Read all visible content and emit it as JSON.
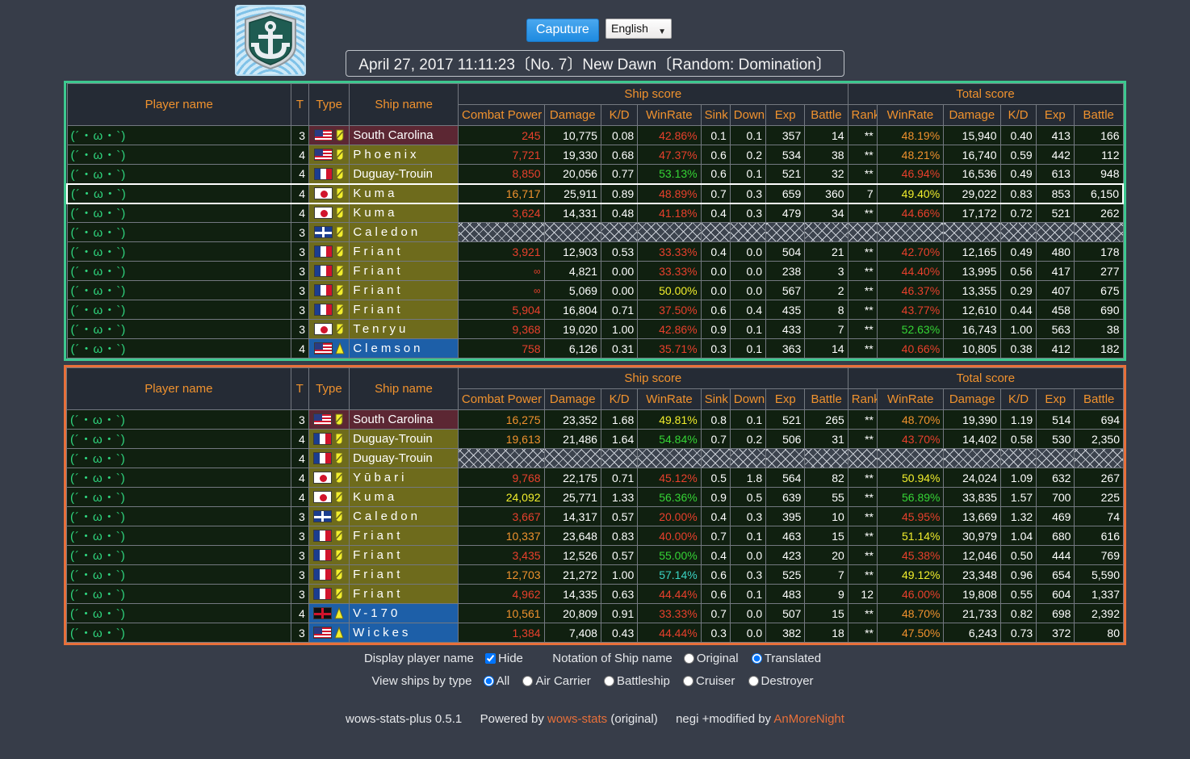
{
  "header": {
    "logo_icon": "wows-anchor-emblem",
    "capture_button": "Caputure",
    "language": "English",
    "battle_title": "April 27, 2017 11:11:23〔No. 7〕New Dawn〔Random: Domination〕"
  },
  "columns": {
    "player": "Player name",
    "tier": "T",
    "type": "Type",
    "ship": "Ship name",
    "ship_score_group": "Ship score",
    "total_score_group": "Total score",
    "combat_power": "Combat Power",
    "damage": "Damage",
    "kd": "K/D",
    "winrate": "WinRate",
    "sink": "Sink",
    "down": "Down",
    "exp": "Exp",
    "battle": "Battle",
    "rank": "Rank",
    "t_winrate": "WinRate",
    "t_damage": "Damage",
    "t_kd": "K/D",
    "t_exp": "Exp",
    "t_battle": "Battle"
  },
  "colors": {
    "ally_border": "#3dc88f",
    "enemy_border": "#e8703a",
    "header_text": "#f0922e",
    "page_bg": "#373d49",
    "row_bg": "#102010",
    "cruiser": "#6e6b1c",
    "battleship": "#5c2733",
    "destroyer": "#1d5fa8"
  },
  "player_name": "(´・ω・`)",
  "teams": [
    {
      "side": "ally",
      "rows": [
        {
          "player": "(´・ω・`)",
          "tier": "3",
          "flag": "usa",
          "cls": "battleship",
          "ship": "South Carolina",
          "wide": false,
          "nodata": false,
          "cp": "245",
          "cp_c": "v-red",
          "dmg": "10,775",
          "kd": "0.08",
          "wr": "42.86%",
          "wr_c": "v-red",
          "sink": "0.1",
          "down": "0.1",
          "exp": "357",
          "battle": "14",
          "rank": "**",
          "twr": "48.19%",
          "twr_c": "v-orange",
          "tdmg": "15,940",
          "tkd": "0.40",
          "texp": "413",
          "tbattle": "166"
        },
        {
          "player": "(´・ω・`)",
          "tier": "4",
          "flag": "usa",
          "cls": "cruiser",
          "ship": "Phoenix",
          "wide": true,
          "nodata": false,
          "cp": "7,721",
          "cp_c": "v-red",
          "dmg": "19,330",
          "kd": "0.68",
          "wr": "47.37%",
          "wr_c": "v-red",
          "sink": "0.6",
          "down": "0.2",
          "exp": "534",
          "battle": "38",
          "rank": "**",
          "twr": "48.21%",
          "twr_c": "v-orange",
          "tdmg": "16,740",
          "tkd": "0.59",
          "texp": "442",
          "tbattle": "112"
        },
        {
          "player": "(´・ω・`)",
          "tier": "4",
          "flag": "france",
          "cls": "cruiser",
          "ship": "Duguay-Trouin",
          "wide": false,
          "nodata": false,
          "cp": "8,850",
          "cp_c": "v-red",
          "dmg": "20,056",
          "kd": "0.77",
          "wr": "53.13%",
          "wr_c": "v-green",
          "sink": "0.6",
          "down": "0.1",
          "exp": "521",
          "battle": "32",
          "rank": "**",
          "twr": "46.94%",
          "twr_c": "v-red",
          "tdmg": "16,536",
          "tkd": "0.49",
          "texp": "613",
          "tbattle": "948"
        },
        {
          "player": "(´・ω・`)",
          "tier": "4",
          "flag": "japan",
          "cls": "cruiser",
          "ship": "Kuma",
          "wide": true,
          "nodata": false,
          "highlight": true,
          "cp": "16,717",
          "cp_c": "v-orange",
          "dmg": "25,911",
          "kd": "0.89",
          "wr": "48.89%",
          "wr_c": "v-red",
          "sink": "0.7",
          "down": "0.3",
          "exp": "659",
          "battle": "360",
          "rank": "7",
          "twr": "49.40%",
          "twr_c": "v-yellow",
          "tdmg": "29,022",
          "tkd": "0.83",
          "texp": "853",
          "tbattle": "6,150"
        },
        {
          "player": "(´・ω・`)",
          "tier": "4",
          "flag": "japan",
          "cls": "cruiser",
          "ship": "Kuma",
          "wide": true,
          "nodata": false,
          "cp": "3,624",
          "cp_c": "v-red",
          "dmg": "14,331",
          "kd": "0.48",
          "wr": "41.18%",
          "wr_c": "v-red",
          "sink": "0.4",
          "down": "0.3",
          "exp": "479",
          "battle": "34",
          "rank": "**",
          "twr": "44.66%",
          "twr_c": "v-red",
          "tdmg": "17,172",
          "tkd": "0.72",
          "texp": "521",
          "tbattle": "262"
        },
        {
          "player": "(´・ω・`)",
          "tier": "3",
          "flag": "uk",
          "cls": "cruiser",
          "ship": "Caledon",
          "wide": true,
          "nodata": true,
          "cp": "",
          "cp_c": "",
          "dmg": "",
          "kd": "",
          "wr": "",
          "wr_c": "",
          "sink": "",
          "down": "",
          "exp": "",
          "battle": "",
          "rank": "",
          "twr": "",
          "twr_c": "",
          "tdmg": "",
          "tkd": "",
          "texp": "",
          "tbattle": ""
        },
        {
          "player": "(´・ω・`)",
          "tier": "3",
          "flag": "france",
          "cls": "cruiser",
          "ship": "Friant",
          "wide": true,
          "nodata": false,
          "cp": "3,921",
          "cp_c": "v-red",
          "dmg": "12,903",
          "kd": "0.53",
          "wr": "33.33%",
          "wr_c": "v-red",
          "sink": "0.4",
          "down": "0.0",
          "exp": "504",
          "battle": "21",
          "rank": "**",
          "twr": "42.70%",
          "twr_c": "v-red",
          "tdmg": "12,165",
          "tkd": "0.49",
          "texp": "480",
          "tbattle": "178"
        },
        {
          "player": "(´・ω・`)",
          "tier": "3",
          "flag": "france",
          "cls": "cruiser",
          "ship": "Friant",
          "wide": true,
          "nodata": false,
          "cp": "∞",
          "cp_c": "inf",
          "dmg": "4,821",
          "kd": "0.00",
          "wr": "33.33%",
          "wr_c": "v-red",
          "sink": "0.0",
          "down": "0.0",
          "exp": "238",
          "battle": "3",
          "rank": "**",
          "twr": "44.40%",
          "twr_c": "v-red",
          "tdmg": "13,995",
          "tkd": "0.56",
          "texp": "417",
          "tbattle": "277"
        },
        {
          "player": "(´・ω・`)",
          "tier": "3",
          "flag": "france",
          "cls": "cruiser",
          "ship": "Friant",
          "wide": true,
          "nodata": false,
          "cp": "∞",
          "cp_c": "inf",
          "dmg": "5,069",
          "kd": "0.00",
          "wr": "50.00%",
          "wr_c": "v-yellow",
          "sink": "0.0",
          "down": "0.0",
          "exp": "567",
          "battle": "2",
          "rank": "**",
          "twr": "46.37%",
          "twr_c": "v-red",
          "tdmg": "13,355",
          "tkd": "0.29",
          "texp": "407",
          "tbattle": "675"
        },
        {
          "player": "(´・ω・`)",
          "tier": "3",
          "flag": "france",
          "cls": "cruiser",
          "ship": "Friant",
          "wide": true,
          "nodata": false,
          "cp": "5,904",
          "cp_c": "v-red",
          "dmg": "16,804",
          "kd": "0.71",
          "wr": "37.50%",
          "wr_c": "v-red",
          "sink": "0.6",
          "down": "0.4",
          "exp": "435",
          "battle": "8",
          "rank": "**",
          "twr": "43.77%",
          "twr_c": "v-red",
          "tdmg": "12,610",
          "tkd": "0.44",
          "texp": "458",
          "tbattle": "690"
        },
        {
          "player": "(´・ω・`)",
          "tier": "3",
          "flag": "japan",
          "cls": "cruiser",
          "ship": "Tenryu",
          "wide": true,
          "nodata": false,
          "cp": "9,368",
          "cp_c": "v-red",
          "dmg": "19,020",
          "kd": "1.00",
          "wr": "42.86%",
          "wr_c": "v-red",
          "sink": "0.9",
          "down": "0.1",
          "exp": "433",
          "battle": "7",
          "rank": "**",
          "twr": "52.63%",
          "twr_c": "v-green",
          "tdmg": "16,743",
          "tkd": "1.00",
          "texp": "563",
          "tbattle": "38"
        },
        {
          "player": "(´・ω・`)",
          "tier": "4",
          "flag": "usa",
          "cls": "destroyer",
          "ship": "Clemson",
          "wide": true,
          "nodata": false,
          "cp": "758",
          "cp_c": "v-red",
          "dmg": "6,126",
          "kd": "0.31",
          "wr": "35.71%",
          "wr_c": "v-red",
          "sink": "0.3",
          "down": "0.1",
          "exp": "363",
          "battle": "14",
          "rank": "**",
          "twr": "40.66%",
          "twr_c": "v-red",
          "tdmg": "10,805",
          "tkd": "0.38",
          "texp": "412",
          "tbattle": "182"
        }
      ]
    },
    {
      "side": "enemy",
      "rows": [
        {
          "player": "(´・ω・`)",
          "tier": "3",
          "flag": "usa",
          "cls": "battleship",
          "ship": "South Carolina",
          "wide": false,
          "nodata": false,
          "cp": "16,275",
          "cp_c": "v-orange",
          "dmg": "23,352",
          "kd": "1.68",
          "wr": "49.81%",
          "wr_c": "v-yellow",
          "sink": "0.8",
          "down": "0.1",
          "exp": "521",
          "battle": "265",
          "rank": "**",
          "twr": "48.70%",
          "twr_c": "v-orange",
          "tdmg": "19,390",
          "tkd": "1.19",
          "texp": "514",
          "tbattle": "694"
        },
        {
          "player": "(´・ω・`)",
          "tier": "4",
          "flag": "france",
          "cls": "cruiser",
          "ship": "Duguay-Trouin",
          "wide": false,
          "nodata": false,
          "cp": "19,613",
          "cp_c": "v-orange",
          "dmg": "21,486",
          "kd": "1.64",
          "wr": "54.84%",
          "wr_c": "v-green",
          "sink": "0.7",
          "down": "0.2",
          "exp": "506",
          "battle": "31",
          "rank": "**",
          "twr": "43.70%",
          "twr_c": "v-red",
          "tdmg": "14,402",
          "tkd": "0.58",
          "texp": "530",
          "tbattle": "2,350"
        },
        {
          "player": "(´・ω・`)",
          "tier": "4",
          "flag": "france",
          "cls": "cruiser",
          "ship": "Duguay-Trouin",
          "wide": false,
          "nodata": true,
          "cp": "",
          "cp_c": "",
          "dmg": "",
          "kd": "",
          "wr": "",
          "wr_c": "",
          "sink": "",
          "down": "",
          "exp": "",
          "battle": "",
          "rank": "",
          "twr": "",
          "twr_c": "",
          "tdmg": "",
          "tkd": "",
          "texp": "",
          "tbattle": ""
        },
        {
          "player": "(´・ω・`)",
          "tier": "4",
          "flag": "japan",
          "cls": "cruiser",
          "ship": "Yūbari",
          "wide": true,
          "nodata": false,
          "cp": "9,768",
          "cp_c": "v-red",
          "dmg": "22,175",
          "kd": "0.71",
          "wr": "45.12%",
          "wr_c": "v-red",
          "sink": "0.5",
          "down": "1.8",
          "exp": "564",
          "battle": "82",
          "rank": "**",
          "twr": "50.94%",
          "twr_c": "v-yellow",
          "tdmg": "24,024",
          "tkd": "1.09",
          "texp": "632",
          "tbattle": "267"
        },
        {
          "player": "(´・ω・`)",
          "tier": "4",
          "flag": "japan",
          "cls": "cruiser",
          "ship": "Kuma",
          "wide": true,
          "nodata": false,
          "cp": "24,092",
          "cp_c": "v-yellow",
          "dmg": "25,771",
          "kd": "1.33",
          "wr": "56.36%",
          "wr_c": "v-green",
          "sink": "0.9",
          "down": "0.5",
          "exp": "639",
          "battle": "55",
          "rank": "**",
          "twr": "56.89%",
          "twr_c": "v-green",
          "tdmg": "33,835",
          "tkd": "1.57",
          "texp": "700",
          "tbattle": "225"
        },
        {
          "player": "(´・ω・`)",
          "tier": "3",
          "flag": "uk",
          "cls": "cruiser",
          "ship": "Caledon",
          "wide": true,
          "nodata": false,
          "cp": "3,667",
          "cp_c": "v-red",
          "dmg": "14,317",
          "kd": "0.57",
          "wr": "20.00%",
          "wr_c": "v-red",
          "sink": "0.4",
          "down": "0.3",
          "exp": "395",
          "battle": "10",
          "rank": "**",
          "twr": "45.95%",
          "twr_c": "v-red",
          "tdmg": "13,669",
          "tkd": "1.32",
          "texp": "469",
          "tbattle": "74"
        },
        {
          "player": "(´・ω・`)",
          "tier": "3",
          "flag": "france",
          "cls": "cruiser",
          "ship": "Friant",
          "wide": true,
          "nodata": false,
          "cp": "10,337",
          "cp_c": "v-orange",
          "dmg": "23,648",
          "kd": "0.83",
          "wr": "40.00%",
          "wr_c": "v-red",
          "sink": "0.7",
          "down": "0.1",
          "exp": "463",
          "battle": "15",
          "rank": "**",
          "twr": "51.14%",
          "twr_c": "v-yellow",
          "tdmg": "30,979",
          "tkd": "1.04",
          "texp": "680",
          "tbattle": "616"
        },
        {
          "player": "(´・ω・`)",
          "tier": "3",
          "flag": "france",
          "cls": "cruiser",
          "ship": "Friant",
          "wide": true,
          "nodata": false,
          "cp": "3,435",
          "cp_c": "v-red",
          "dmg": "12,526",
          "kd": "0.57",
          "wr": "55.00%",
          "wr_c": "v-green",
          "sink": "0.4",
          "down": "0.0",
          "exp": "423",
          "battle": "20",
          "rank": "**",
          "twr": "45.38%",
          "twr_c": "v-red",
          "tdmg": "12,046",
          "tkd": "0.50",
          "texp": "444",
          "tbattle": "769"
        },
        {
          "player": "(´・ω・`)",
          "tier": "3",
          "flag": "france",
          "cls": "cruiser",
          "ship": "Friant",
          "wide": true,
          "nodata": false,
          "cp": "12,703",
          "cp_c": "v-orange",
          "dmg": "21,272",
          "kd": "1.00",
          "wr": "57.14%",
          "wr_c": "v-cyan",
          "sink": "0.6",
          "down": "0.3",
          "exp": "525",
          "battle": "7",
          "rank": "**",
          "twr": "49.12%",
          "twr_c": "v-yellow",
          "tdmg": "23,348",
          "tkd": "0.96",
          "texp": "654",
          "tbattle": "5,590"
        },
        {
          "player": "(´・ω・`)",
          "tier": "3",
          "flag": "france",
          "cls": "cruiser",
          "ship": "Friant",
          "wide": true,
          "nodata": false,
          "cp": "4,962",
          "cp_c": "v-red",
          "dmg": "14,335",
          "kd": "0.63",
          "wr": "44.44%",
          "wr_c": "v-red",
          "sink": "0.6",
          "down": "0.1",
          "exp": "483",
          "battle": "9",
          "rank": "12",
          "twr": "46.00%",
          "twr_c": "v-red",
          "tdmg": "19,808",
          "tkd": "0.55",
          "texp": "604",
          "tbattle": "1,337"
        },
        {
          "player": "(´・ω・`)",
          "tier": "4",
          "flag": "germany",
          "cls": "destroyer",
          "ship": "V-170",
          "wide": true,
          "nodata": false,
          "cp": "10,561",
          "cp_c": "v-orange",
          "dmg": "20,809",
          "kd": "0.91",
          "wr": "33.33%",
          "wr_c": "v-red",
          "sink": "0.7",
          "down": "0.0",
          "exp": "507",
          "battle": "15",
          "rank": "**",
          "twr": "48.70%",
          "twr_c": "v-orange",
          "tdmg": "21,733",
          "tkd": "0.82",
          "texp": "698",
          "tbattle": "2,392"
        },
        {
          "player": "(´・ω・`)",
          "tier": "3",
          "flag": "usa",
          "cls": "destroyer",
          "ship": "Wickes",
          "wide": true,
          "nodata": false,
          "cp": "1,384",
          "cp_c": "v-red",
          "dmg": "7,408",
          "kd": "0.43",
          "wr": "44.44%",
          "wr_c": "v-red",
          "sink": "0.3",
          "down": "0.0",
          "exp": "382",
          "battle": "18",
          "rank": "**",
          "twr": "47.50%",
          "twr_c": "v-orange",
          "tdmg": "6,243",
          "tkd": "0.73",
          "texp": "372",
          "tbattle": "80"
        }
      ]
    }
  ],
  "options": {
    "display_player_name_label": "Display player name",
    "hide_label": "Hide",
    "hide_checked": true,
    "notation_label": "Notation of Ship name",
    "notation_options": [
      "Original",
      "Translated"
    ],
    "notation_selected": "Translated",
    "view_by_type_label": "View ships by type",
    "type_options": [
      "All",
      "Air Carrier",
      "Battleship",
      "Cruiser",
      "Destroyer"
    ],
    "type_selected": "All"
  },
  "credits": {
    "version": "wows-stats-plus 0.5.1",
    "powered_by": "Powered by",
    "wows_stats_link": "wows-stats",
    "original": "(original)",
    "negi": "negi +modified by",
    "author_link": "AnMoreNight"
  }
}
